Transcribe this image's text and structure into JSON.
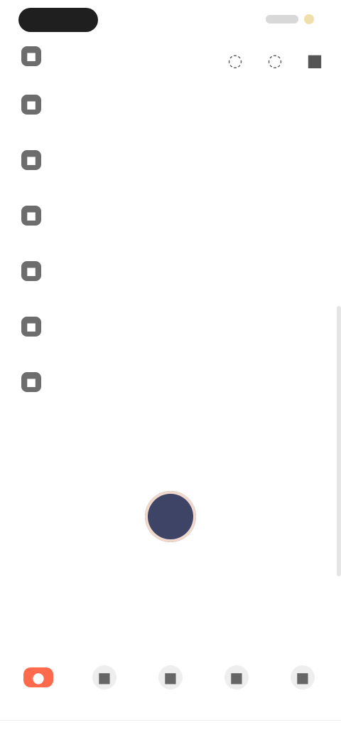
{
  "header": {
    "pill_text": "",
    "status_text": "",
    "status_indicator": "",
    "top_actions": [
      {
        "icon": "chat-icon",
        "glyph": "◌"
      },
      {
        "icon": "notification-icon",
        "glyph": "◌"
      },
      {
        "icon": "more-icon",
        "glyph": "■"
      }
    ]
  },
  "menu": {
    "items": [
      {
        "icon": "settings-icon",
        "glyph": "■",
        "title": "",
        "subtitle": "",
        "chevron": ""
      },
      {
        "icon": "profile-icon",
        "glyph": "■",
        "title": "",
        "subtitle": "",
        "chevron": ""
      },
      {
        "icon": "location-icon",
        "glyph": "■",
        "title": "",
        "subtitle": "",
        "chevron": ""
      },
      {
        "icon": "tag-icon",
        "glyph": "■",
        "title": "",
        "subtitle": "",
        "chevron": ""
      },
      {
        "icon": "document-icon",
        "glyph": "■",
        "title": "",
        "subtitle": "",
        "chevron": ""
      },
      {
        "icon": "help-icon",
        "glyph": "■",
        "title": "",
        "subtitle": "",
        "chevron": ""
      },
      {
        "icon": "info-icon",
        "glyph": "■",
        "title": "",
        "subtitle": "",
        "chevron": ""
      }
    ]
  },
  "content": {
    "section_title": "",
    "avatar_text": "",
    "avatar_name": ""
  },
  "bottom": {
    "label": "",
    "nav_items": [
      {
        "icon": "home-icon",
        "glyph": "●",
        "label": "",
        "active": true
      },
      {
        "icon": "browse-icon",
        "glyph": "■",
        "label": "",
        "active": false
      },
      {
        "icon": "library-icon",
        "glyph": "■",
        "label": "",
        "active": false
      },
      {
        "icon": "search-icon",
        "glyph": "■",
        "label": "",
        "active": false
      },
      {
        "icon": "account-icon",
        "glyph": "■",
        "label": "",
        "active": false
      }
    ]
  },
  "colors": {
    "accent": "#ff6a4d",
    "avatar": "#3e4466",
    "text": "#555555",
    "muted": "#9a9a9a"
  }
}
